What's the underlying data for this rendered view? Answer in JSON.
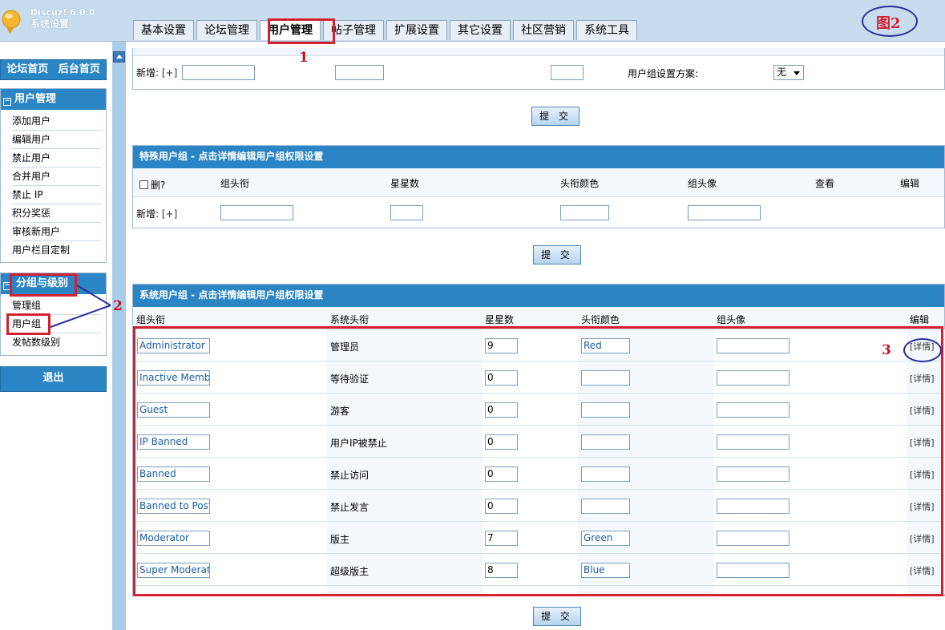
{
  "header": {
    "brand_line1": "Discuz! 6.0.0",
    "brand_line2": "系统设置",
    "tabs": [
      {
        "label": "基本设置"
      },
      {
        "label": "论坛管理"
      },
      {
        "label": "用户管理"
      },
      {
        "label": "帖子管理"
      },
      {
        "label": "扩展设置"
      },
      {
        "label": "其它设置"
      },
      {
        "label": "社区营销"
      },
      {
        "label": "系统工具"
      }
    ],
    "active_tab": "用户管理",
    "figure_label": "图2"
  },
  "sidebar": {
    "top_links": [
      "论坛首页",
      "后台首页"
    ],
    "user_mgmt": {
      "title": "用户管理",
      "toggle": "⊟",
      "items": [
        "添加用户",
        "编辑用户",
        "禁止用户",
        "合并用户",
        "禁止 IP",
        "积分奖惩",
        "审核新用户",
        "用户栏目定制"
      ]
    },
    "groups": {
      "title": "分组与级别",
      "toggle": "⊟",
      "items": [
        "管理组",
        "用户组",
        "发帖数级别"
      ]
    },
    "logout": "退出"
  },
  "member_section": {
    "add_label": "新增:",
    "add_plus": "[+]",
    "scheme_label": "用户组设置方案:",
    "scheme_value": "无",
    "submit": "提 交"
  },
  "special_groups": {
    "title": "特殊用户组 - 点击详情编辑用户组权限设置",
    "columns": [
      "删?",
      "组头衔",
      "星星数",
      "头衔颜色",
      "组头像",
      "查看",
      "编辑"
    ],
    "add_label": "新增:",
    "add_plus": "[+]",
    "submit": "提 交"
  },
  "system_groups": {
    "title": "系统用户组 - 点击详情编辑用户组权限设置",
    "columns": [
      "组头衔",
      "系统头衔",
      "星星数",
      "头衔颜色",
      "组头像",
      "编辑"
    ],
    "rows": [
      {
        "title": "Administrator",
        "system": "管理员",
        "stars": "9",
        "color": "Red",
        "avatar": "",
        "edit": "[详情]"
      },
      {
        "title": "Inactive Member",
        "system": "等待验证",
        "stars": "0",
        "color": "",
        "avatar": "",
        "edit": "[详情]"
      },
      {
        "title": "Guest",
        "system": "游客",
        "stars": "0",
        "color": "",
        "avatar": "",
        "edit": "[详情]"
      },
      {
        "title": "IP Banned",
        "system": "用户IP被禁止",
        "stars": "0",
        "color": "",
        "avatar": "",
        "edit": "[详情]"
      },
      {
        "title": "Banned",
        "system": "禁止访问",
        "stars": "0",
        "color": "",
        "avatar": "",
        "edit": "[详情]"
      },
      {
        "title": "Banned to Post",
        "system": "禁止发言",
        "stars": "0",
        "color": "",
        "avatar": "",
        "edit": "[详情]"
      },
      {
        "title": "Moderator",
        "system": "版主",
        "stars": "7",
        "color": "Green",
        "avatar": "",
        "edit": "[详情]"
      },
      {
        "title": "Super Moderato",
        "system": "超级版主",
        "stars": "8",
        "color": "Blue",
        "avatar": "",
        "edit": "[详情]"
      }
    ],
    "submit": "提 交"
  },
  "annotations": {
    "n1": "1",
    "n2": "2",
    "n3": "3"
  },
  "colors": {
    "nav_blue": "#2b84c4",
    "annotation_red": "#d42030",
    "annotation_blue": "#2a2f9c"
  }
}
